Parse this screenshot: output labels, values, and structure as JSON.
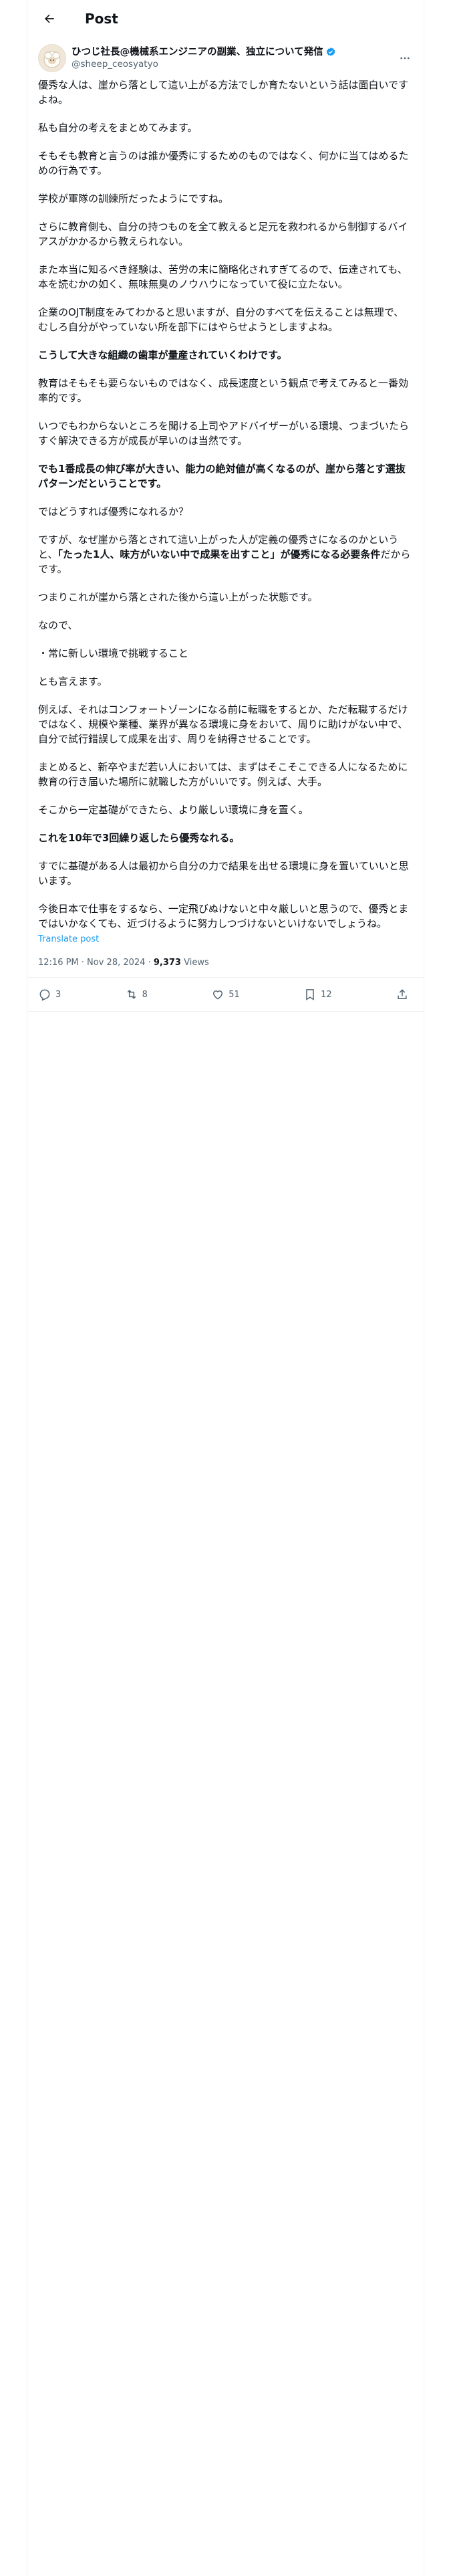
{
  "header": {
    "title": "Post"
  },
  "author": {
    "name": "ひつじ社長@機械系エンジニアの副業、独立について発信",
    "handle": "@sheep_ceosyatyo"
  },
  "post": {
    "paragraphs": [
      "優秀な人は、崖から落として這い上がる方法でしか育たないという話は面白いですよね。",
      "私も自分の考えをまとめてみます。",
      "そもそも教育と言うのは誰か優秀にするためのものではなく、何かに当てはめるための行為です。",
      "学校が軍隊の訓練所だったようにですね。",
      "さらに教育側も、自分の持つものを全て教えると足元を救われるから制御するバイアスがかかるから教えられない。",
      "また本当に知るべき経験は、苦労の末に簡略化されすぎてるので、伝達されても、本を読むかの如く、無味無臭のノウハウになっていて役に立たない。",
      "企業のOJT制度をみてわかると思いますが、自分のすべてを伝えることは無理で、むしろ自分がやっていない所を部下にはやらせようとしますよね。",
      "こうして大きな組織の歯車が量産されていくわけです。",
      "教育はそもそも要らないものではなく、成長速度という観点で考えてみると一番効率的です。",
      "いつでもわからないところを聞ける上司やアドバイザーがいる環境、つまづいたらすぐ解決できる方が成長が早いのは当然です。",
      "でも1番成長の伸び率が大きい、能力の絶対値が高くなるのが、崖から落とす選抜パターンだということです。",
      "ではどうすれば優秀になれるか？",
      "ですが、なぜ崖から落とされて這い上がった人が定義の優秀さになるのかというと、",
      "「たった1人、味方がいない中で成果を出すこと」が優秀になる必要条件",
      "だからです。",
      "つまりこれが崖から落とされた後から這い上がった状態です。",
      "なので、",
      "・常に新しい環境で挑戦すること",
      "とも言えます。",
      "例えば、それはコンフォートゾーンになる前に転職をするとか、ただ転職するだけではなく、規模や業種、業界が異なる環境に身をおいて、周りに助けがない中で、自分で試行錯誤して成果を出す、周りを納得させることです。",
      "まとめると、新卒やまだ若い人においては、まずはそこそこできる人になるために教育の行き届いた場所に就職した方がいいです。例えば、大手。",
      "そこから一定基礎ができたら、より厳しい環境に身を置く。",
      "これを10年で3回繰り返したら優秀なれる。",
      "すでに基礎がある人は最初から自分の力で結果を出せる環境に身を置いていいと思います。",
      "今後日本で仕事をするなら、一定飛びぬけないと中々厳しいと思うので、優秀とまではいかなくても、近づけるように努力しつづけないといけないでしょうね。"
    ],
    "translate": "Translate post",
    "time": "12:16 PM · Nov 28, 2024 · ",
    "views_count": "9,373",
    "views_label": " Views"
  },
  "actions": {
    "replies": "3",
    "reposts": "8",
    "likes": "51",
    "bookmarks": "12"
  }
}
